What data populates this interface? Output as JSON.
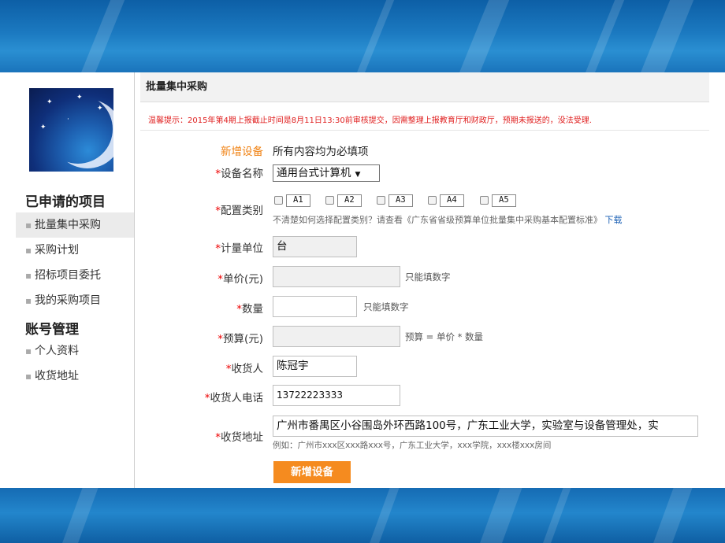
{
  "sidebar": {
    "section1_title": "已申请的项目",
    "items1": [
      "批量集中采购",
      "采购计划",
      "招标项目委托",
      "我的采购项目"
    ],
    "section2_title": "账号管理",
    "items2": [
      "个人资料",
      "收货地址"
    ]
  },
  "header": {
    "title": "批量集中采购"
  },
  "notice": "温馨提示：2015年第4期上报截止时间是8月11日13:30前审核提交，因需整理上报教育厅和财政厅，预期未报送的，没法受理.",
  "form": {
    "new_device_label": "新增设备",
    "new_device_note": "所有内容均为必填项",
    "device_name": {
      "label": "设备名称",
      "value": "通用台式计算机"
    },
    "config": {
      "label": "配置类别",
      "options": [
        "A1",
        "A2",
        "A3",
        "A4",
        "A5"
      ],
      "hint": "不清楚如何选择配置类别？请查看《广东省省级预算单位批量集中采购基本配置标准》",
      "download": "下载"
    },
    "unit": {
      "label": "计量单位",
      "value": "台"
    },
    "price": {
      "label": "单价(元)",
      "value": "",
      "hint": "只能填数字"
    },
    "qty": {
      "label": "数量",
      "value": "",
      "hint": "只能填数字"
    },
    "budget": {
      "label": "预算(元)",
      "value": "",
      "hint": "预算 = 单价 * 数量"
    },
    "receiver": {
      "label": "收货人",
      "value": "陈冠宇"
    },
    "phone": {
      "label": "收货人电话",
      "value": "13722223333"
    },
    "address": {
      "label": "收货地址",
      "value": "广州市番禺区小谷围岛外环西路100号，广东工业大学，实验室与设备管理处，实",
      "example": "例如：广州市xxx区xxx路xxx号，广东工业大学，xxx学院，xxx楼xxx房间"
    },
    "required_mark": "*",
    "submit": "新增设备"
  }
}
